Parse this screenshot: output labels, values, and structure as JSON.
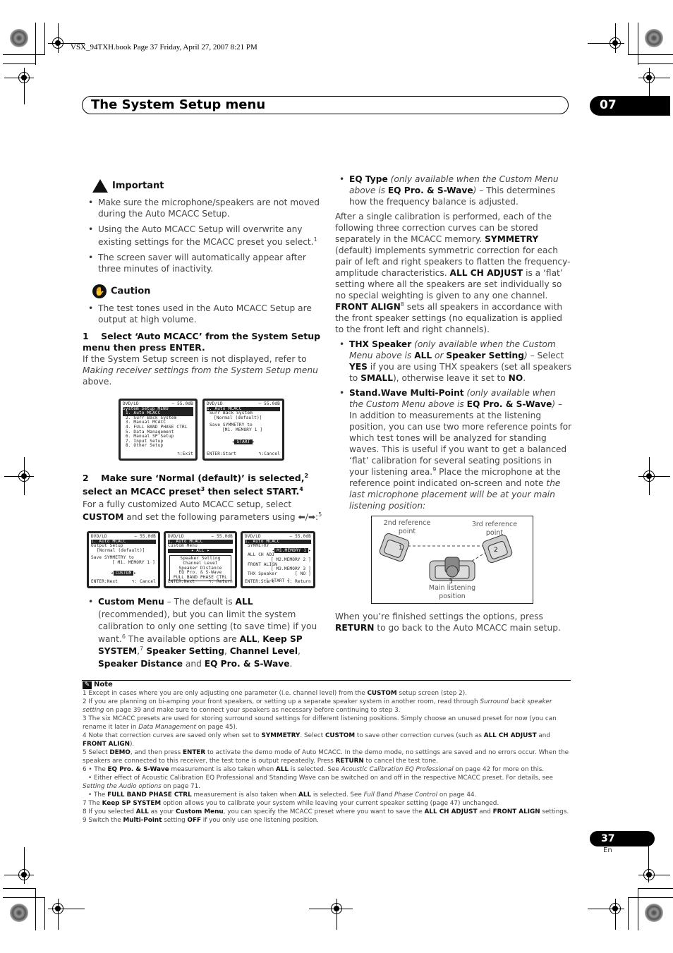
{
  "print_info": "VSX_94TXH.book  Page 37  Friday, April 27, 2007  8:21 PM",
  "header": {
    "title": "The System Setup menu",
    "chapter": "07"
  },
  "important": {
    "icon": "warning-hand-icon",
    "title": "Important",
    "items": [
      "Make sure the microphone/speakers are not moved during the Auto MCACC Setup.",
      "Using the Auto MCACC Setup will overwrite any existing settings for the MCACC preset you select.",
      "The screen saver will automatically appear after three minutes of inactivity."
    ],
    "item2_sup": "1"
  },
  "caution": {
    "icon": "stop-hand-icon",
    "title": "Caution",
    "items": [
      "The test tones used in the Auto MCACC Setup are output at high volume."
    ]
  },
  "step1": {
    "number": "1",
    "heading": "Select ‘Auto MCACC’ from the System Setup menu then press ENTER.",
    "body_pre": "If the System Setup screen is not displayed, refer to ",
    "body_link": "Making receiver settings from the System Setup menu",
    "body_post": " above."
  },
  "osd1": {
    "source": "DVD/LD",
    "level": "– 55.0dB",
    "title": "System Setup MENU",
    "items": [
      "1. Auto MCACC",
      "2. Surr Back System",
      "3. Manual MCACC",
      "4. FULL BAND PHASE CTRL",
      "5. Data Management",
      "6. Manual SP Setup",
      "7. Input Setup",
      "8. Other Setup"
    ],
    "footer_right": ":Exit"
  },
  "osd2": {
    "source": "DVD/LD",
    "level": "– 55.0dB",
    "title": "1. Auto MCACC",
    "line1": "Surr Back System",
    "line2": "[Normal (default)]",
    "line3": "Save SYMMETRY to",
    "line4": "[M1. MEMORY 1      ]",
    "button": "START",
    "footer_left": "ENTER:Start",
    "footer_right": ":Cancel"
  },
  "step2": {
    "number": "2",
    "heading_a": "Make sure ‘Normal (default)’ is selected,",
    "sup_a": "2",
    "heading_b": " select an MCACC preset",
    "sup_b": "3",
    "heading_c": " then select START.",
    "sup_c": "4",
    "body_pre": "For a fully customized Auto MCACC setup, select ",
    "body_bold": "CUSTOM",
    "body_post": " and set the following parameters using ⬅/➡:",
    "body_sup": "5"
  },
  "osd3": {
    "source": "DVD/LD",
    "level": "– 55.0dB",
    "title": "1. Auto MCACC",
    "line1": "Output Setup",
    "line2": "[Normal (default)]",
    "line3": "Save SYMMETRY to",
    "line4": "[ M1. MEMORY 1   ]",
    "button": "CUSTOM",
    "footer_left": "ENTER:Next",
    "footer_right": ": Cancel"
  },
  "osd4": {
    "source": "DVD/LD",
    "level": "– 55.0dB",
    "title": "1. Auto MCACC",
    "line1": "Custom Menu",
    "selected": "ALL",
    "options": [
      "Speaker Setting",
      "Channel Level",
      "Speaker Distance",
      "EQ Pro. & S-Wave",
      "FULL BAND PHASE CTRL"
    ],
    "footer_left": "ENTER:Next",
    "footer_right": ": Return"
  },
  "osd5": {
    "source": "DVD/LD",
    "level": "– 55.0dB",
    "title": "1. Auto MCACC",
    "l1": "SYMMETRY",
    "v1": "M1.MEMORY 1",
    "l2": "ALL CH ADJ",
    "v2": "[ M2.MEMORY 2 ]",
    "l3": "FRONT ALIGN",
    "v3": "[ M3.MEMORY 3 ]",
    "l4": "THX Speaker",
    "v4": "[  NO  ]",
    "button": "[ START ]",
    "footer_left": "ENTER:Start",
    "footer_right": ": Return"
  },
  "custom_menu": {
    "term": "Custom Menu",
    "t1": " – The default is ",
    "b1": "ALL",
    "t2": " (recommended), but you can limit the system calibration to only one setting (to save time) if you want.",
    "sup1": "6",
    "t3": " The available options are ",
    "b2": "ALL",
    "t4": ", ",
    "b3": "Keep SP SYSTEM",
    "t5": ",",
    "sup2": "7",
    "b4": " Speaker Setting",
    "t6": ", ",
    "b5": "Channel Level",
    "t7": ", ",
    "b6": "Speaker Distance",
    "t8": " and ",
    "b7": "EQ Pro. & S-Wave",
    "t9": "."
  },
  "eq_type": {
    "term": "EQ Type",
    "i1": " (only available when the Custom Menu above is ",
    "b1": "EQ Pro. & S-Wave",
    "i2": ")",
    "t1": " – This determines how the frequency balance is adjusted."
  },
  "curves_para": {
    "t1": "After a single calibration is performed, each of the following three correction curves can be stored separately in the MCACC memory. ",
    "b1": "SYMMETRY",
    "t2": " (default) implements symmetric correction for each pair of left and right speakers to flatten the frequency-amplitude characteristics. ",
    "b2": "ALL CH ADJUST",
    "t3": " is a ‘flat’ setting where all the speakers are set individually so no special weighting is given to any one channel. ",
    "b3": "FRONT ALIGN",
    "sup": "8",
    "t4": " sets all speakers in accordance with the front speaker settings (no equalization is applied to the front left and right channels)."
  },
  "thx": {
    "term": "THX Speaker",
    "i1": " (only available when the Custom Menu above is ",
    "b1": "ALL",
    "i2": " or ",
    "b2": "Speaker Setting",
    "i3": ")",
    "t1": " – Select ",
    "b3": "YES",
    "t2": " if you are using THX speakers (set all speakers to ",
    "b4": "SMALL",
    "t3": "), otherwise leave it set to ",
    "b5": "NO",
    "t4": "."
  },
  "standwave": {
    "term": "Stand.Wave Multi-Point",
    "i1": " (only available when the Custom Menu above is ",
    "b1": "EQ Pro. & S-Wave",
    "i2": ")",
    "t1": " – In addition to measurements at the listening position, you can use two more reference points for which test tones will be analyzed for standing waves. This is useful if you want to get a balanced ‘flat’ calibration for several seating positions in your listening area.",
    "sup": "9",
    "t2": " Place the microphone at the reference point indicated on-screen and note ",
    "i3": "the last microphone placement will be at your main listening position:"
  },
  "diagram": {
    "label_2nd": "2nd reference point",
    "label_3rd": "3rd reference point",
    "label_main": "Main listening position",
    "n1": "1",
    "n2": "2",
    "n3": "3"
  },
  "finish": {
    "t1": "When you’re finished settings the options, press ",
    "b1": "RETURN",
    "t2": " to go back to the Auto MCACC main setup."
  },
  "notes": {
    "title": "Note",
    "n1": {
      "a": "1  Except in cases where you are only adjusting one parameter (i.e. channel level) from the ",
      "b": "CUSTOM",
      "c": " setup screen (step 2)."
    },
    "n2": {
      "a": "2  If you are planning on bi-amping your front speakers, or setting up a separate speaker system in another room, read through ",
      "i": "Surround back speaker setting",
      "c": " on page 39 and make sure to connect your speakers as necessary before continuing to step 3."
    },
    "n3": {
      "a": "3  The six MCACC presets are used for storing surround sound settings for different listening positions. Simply choose an unused preset for now (you can rename it later in ",
      "i": "Data Management",
      "c": " on page 45)."
    },
    "n4": {
      "a": "4  Note that correction curves are saved only when set to ",
      "b1": "SYMMETRY",
      "c": ". Select ",
      "b2": "CUSTOM",
      "d": " to save other correction curves (such as ",
      "b3": "ALL CH ADJUST",
      "e": " and ",
      "b4": "FRONT ALIGN",
      "f": ")."
    },
    "n5": {
      "a": "5  Select ",
      "b1": "DEMO",
      "c": ", and then press ",
      "b2": "ENTER",
      "d": " to activate the demo mode of Auto MCACC. In the demo mode, no settings are saved and no errors occur. When the speakers are connected to this receiver, the test tone is output repeatedly. Press ",
      "b3": "RETURN",
      "e": " to cancel the test tone."
    },
    "n6a": {
      "a": "6  • The ",
      "b1": "EQ Pro. & S-Wave",
      "c": " measurement is also taken when ",
      "b2": "ALL",
      "d": " is selected. See ",
      "i": "Acoustic Calibration EQ Professional",
      "e": " on page 42 for more on this."
    },
    "n6b": {
      "a": "• Either effect of Acoustic Calibration EQ Professional and Standing Wave can be switched on and off in the respective MCACC preset. For details, see ",
      "i": "Setting the Audio options",
      "c": " on page 71."
    },
    "n6c": {
      "a": "• The ",
      "b1": "FULL BAND PHASE CTRL",
      "c": " measurement is also taken when ",
      "b2": "ALL",
      "d": " is selected. See ",
      "i": "Full Band Phase Control",
      "e": " on page 44."
    },
    "n7": {
      "a": "7  The ",
      "b": "Keep SP SYSTEM",
      "c": " option allows you to calibrate your system while leaving your current speaker setting (page 47) unchanged."
    },
    "n8": {
      "a": "8  If you selected ",
      "b1": "ALL",
      "c": " as your ",
      "b2": "Custom Menu",
      "d": ", you can specify the MCACC preset where you want to save the ",
      "b3": "ALL CH ADJUST",
      "e": " and ",
      "b4": "FRONT ALIGN",
      "f": " settings."
    },
    "n9": {
      "a": "9  Switch the ",
      "b1": "Multi-Point",
      "c": " setting ",
      "b2": "OFF",
      "d": " if you only use one listening position."
    }
  },
  "footer": {
    "page": "37",
    "lang": "En"
  }
}
